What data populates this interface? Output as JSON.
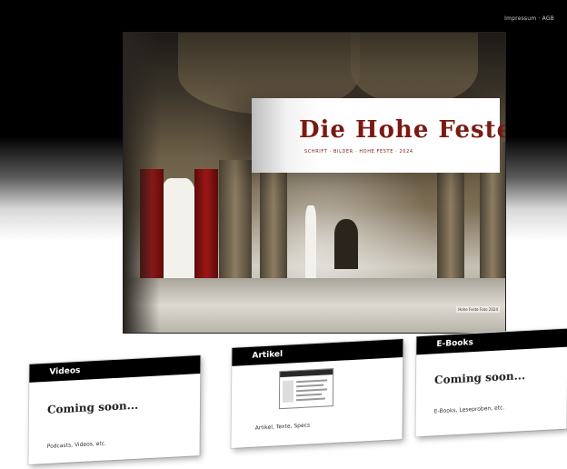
{
  "topbar": {
    "link_text": "Impressum · AGB"
  },
  "hero": {
    "title": "Die Hohe Feste",
    "tagline": "SCHRIFT · BILDER · HOHE FESTE · 2024",
    "credit": "Hohe Feste Foto 2024"
  },
  "cards": [
    {
      "title": "Videos",
      "coming": "Coming soon...",
      "desc": "Podcasts, Videos, etc."
    },
    {
      "title": "Artikel",
      "desc": "Artikel, Texte, Specs"
    },
    {
      "title": "E-Books",
      "coming": "Coming soon...",
      "desc": "E-Books, Leseproben, etc."
    }
  ],
  "colors": {
    "banner_title": "#7a1a12",
    "card_header": "#000000",
    "card_body": "#ffffff"
  }
}
